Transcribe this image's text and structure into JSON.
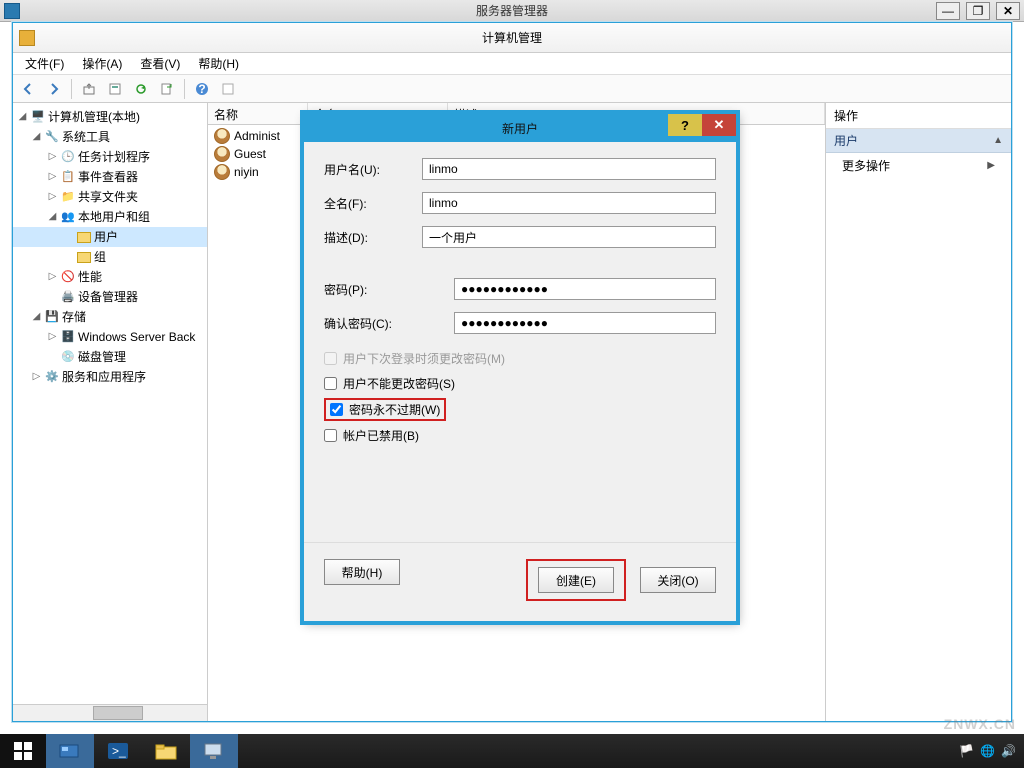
{
  "parent_window": {
    "title": "服务器管理器"
  },
  "main_window": {
    "title": "计算机管理"
  },
  "menu": {
    "file": "文件(F)",
    "action": "操作(A)",
    "view": "查看(V)",
    "help": "帮助(H)"
  },
  "tree": {
    "root": "计算机管理(本地)",
    "system_tools": "系统工具",
    "task_scheduler": "任务计划程序",
    "event_viewer": "事件查看器",
    "shared_folders": "共享文件夹",
    "local_users_groups": "本地用户和组",
    "users": "用户",
    "groups": "组",
    "performance": "性能",
    "device_manager": "设备管理器",
    "storage": "存储",
    "wsb": "Windows Server Back",
    "disk_mgmt": "磁盘管理",
    "services_apps": "服务和应用程序"
  },
  "list": {
    "col_name": "名称",
    "col_fullname": "全名",
    "col_desc": "描述",
    "rows": [
      {
        "name": "Administ"
      },
      {
        "name": "Guest"
      },
      {
        "name": "niyin"
      }
    ]
  },
  "actions": {
    "header": "操作",
    "users": "用户",
    "more": "更多操作"
  },
  "dialog": {
    "title": "新用户",
    "username_label": "用户名(U):",
    "username_value": "linmo",
    "fullname_label": "全名(F):",
    "fullname_value": "linmo",
    "desc_label": "描述(D):",
    "desc_value": "一个用户",
    "password_label": "密码(P):",
    "password_value": "●●●●●●●●●●●●",
    "confirm_label": "确认密码(C):",
    "confirm_value": "●●●●●●●●●●●●",
    "must_change": "用户下次登录时须更改密码(M)",
    "cannot_change": "用户不能更改密码(S)",
    "never_expires": "密码永不过期(W)",
    "disabled": "帐户已禁用(B)",
    "help_btn": "帮助(H)",
    "create_btn": "创建(E)",
    "close_btn": "关闭(O)"
  },
  "watermark": "ZNWX.CN"
}
